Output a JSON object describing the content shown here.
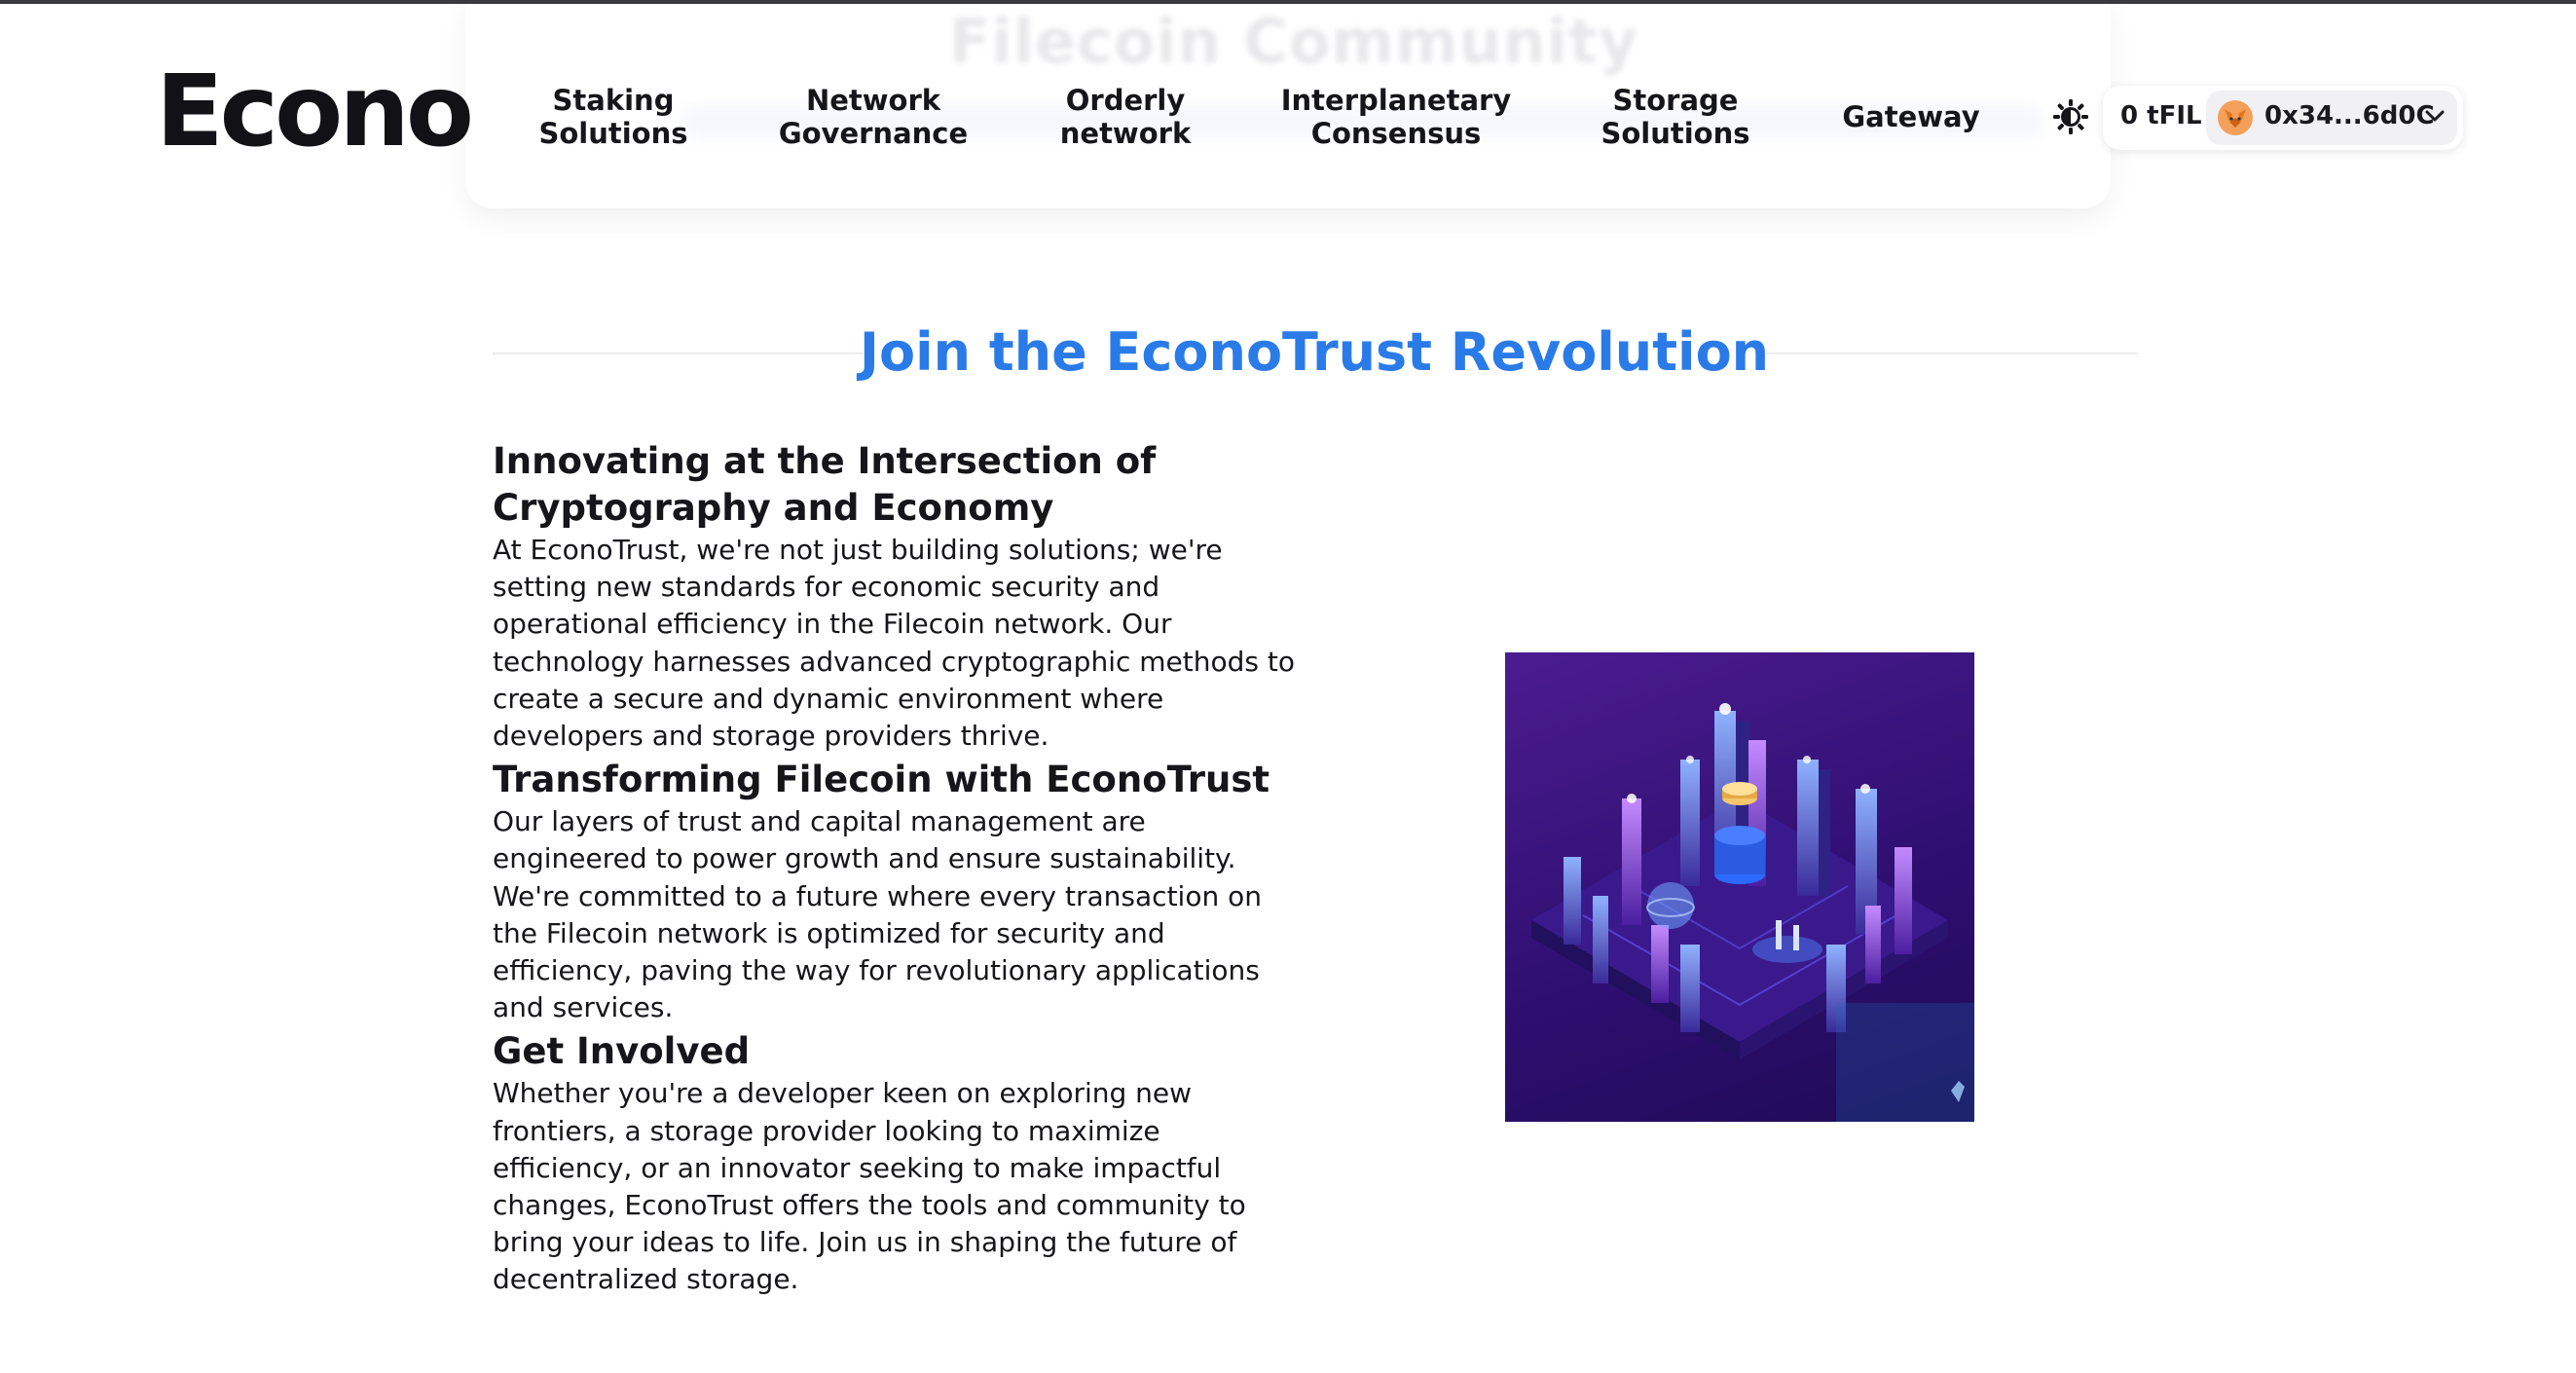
{
  "ghost_heading": "Filecoin Community",
  "logo": {
    "text": "Econo"
  },
  "nav": {
    "links": [
      {
        "line1": "Staking",
        "line2": "Solutions"
      },
      {
        "line1": "Network",
        "line2": "Governance"
      },
      {
        "line1": "Orderly",
        "line2": "network"
      },
      {
        "line1": "Interplanetary",
        "line2": "Consensus"
      },
      {
        "line1": "Storage",
        "line2": "Solutions"
      },
      {
        "line1": "Gateway",
        "line2": ""
      }
    ],
    "theme_icon": "sun-icon",
    "balance": "0 tFIL",
    "account": {
      "avatar_icon": "metamask-fox-icon",
      "address": "0x34...6d0C",
      "chevron_icon": "chevron-down-icon"
    }
  },
  "section": {
    "title": "Join the EconoTrust Revolution"
  },
  "content": {
    "blocks": [
      {
        "heading": "Innovating at the Intersection of Cryptography and Economy",
        "body": "At EconoTrust, we're not just building solutions; we're setting new standards for economic security and operational efficiency in the Filecoin network. Our technology harnesses advanced cryptographic methods to create a secure and dynamic environment where developers and storage providers thrive."
      },
      {
        "heading": "Transforming Filecoin with EconoTrust",
        "body": "Our layers of trust and capital management are engineered to power growth and ensure sustainability. We're committed to a future where every transaction on the Filecoin network is optimized for security and efficiency, paving the way for revolutionary applications and services."
      },
      {
        "heading": "Get Involved",
        "body": "Whether you're a developer keen on exploring new frontiers, a storage provider looking to maximize efficiency, or an innovator seeking to make impactful changes, EconoTrust offers the tools and community to bring your ideas to life. Join us in shaping the future of decentralized storage."
      }
    ]
  },
  "colors": {
    "accent": "#2a7be8",
    "text": "#16161a",
    "hero_bg": "#2f0f72"
  }
}
